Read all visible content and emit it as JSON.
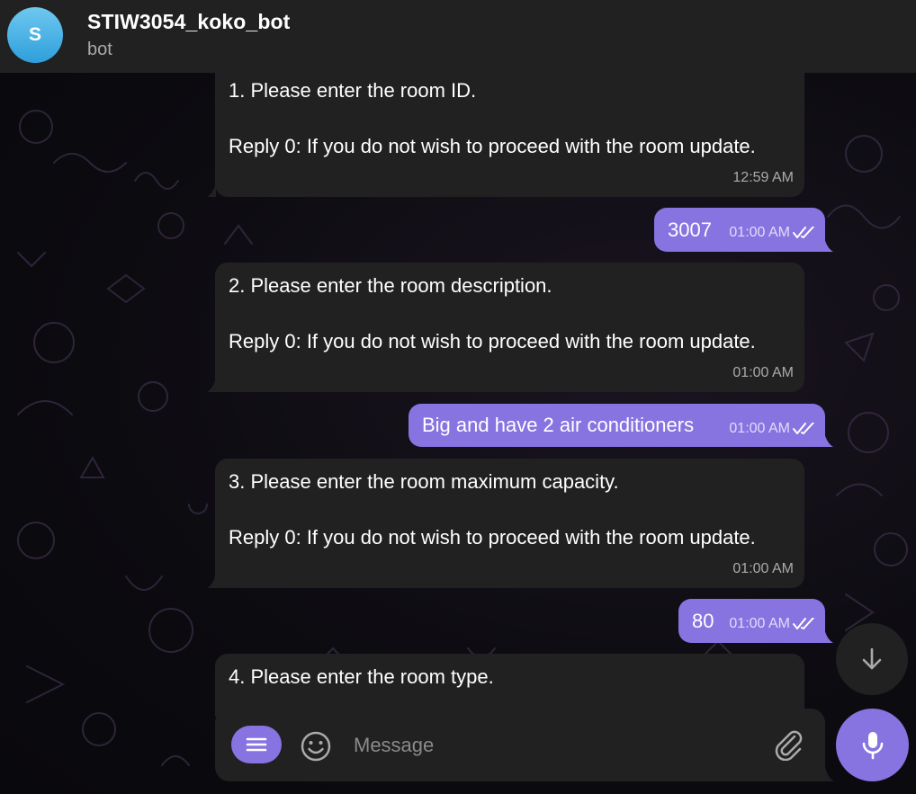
{
  "header": {
    "avatar_letter": "S",
    "title": "STIW3054_koko_bot",
    "subtitle": "bot"
  },
  "messages": [
    {
      "direction": "in",
      "text": "1. Please enter the room ID.\n\nReply 0: If you do not wish to proceed with the room update.",
      "time": "12:59 AM"
    },
    {
      "direction": "out",
      "text": "3007",
      "time": "01:00 AM",
      "status": "read"
    },
    {
      "direction": "in",
      "text": "2. Please enter the room description.\n\nReply 0: If you do not wish to proceed with the room update.",
      "time": "01:00 AM"
    },
    {
      "direction": "out",
      "text": "Big and have 2 air conditioners",
      "time": "01:00 AM",
      "status": "read"
    },
    {
      "direction": "in",
      "text": "3. Please enter the room maximum capacity.\n\nReply 0: If you do not wish to proceed with the room update.",
      "time": "01:00 AM"
    },
    {
      "direction": "out",
      "text": "80",
      "time": "01:00 AM",
      "status": "read"
    },
    {
      "direction": "in",
      "text": "4. Please enter the room type.",
      "time": ""
    }
  ],
  "composer": {
    "placeholder": "Message",
    "value": ""
  },
  "icons": {
    "menu": "menu-icon",
    "emoji": "smile-icon",
    "attach": "paperclip-icon",
    "mic": "microphone-icon",
    "scroll_down": "arrow-down-icon",
    "read_status": "double-check-icon"
  },
  "colors": {
    "accent": "#8774e1",
    "header_bg": "#212121",
    "incoming_bubble": "#212121",
    "outgoing_bubble": "#8774e1",
    "avatar": "#3aa6e0"
  }
}
